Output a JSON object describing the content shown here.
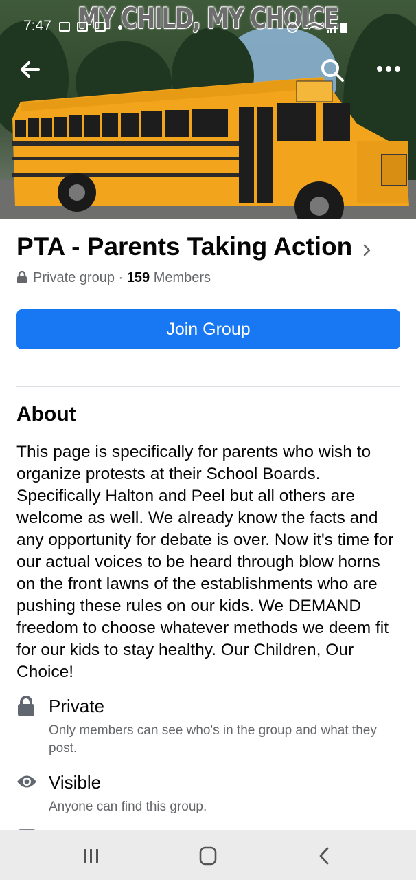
{
  "status_bar": {
    "time": "7:47"
  },
  "cover": {
    "overlay_text": "MY CHILD, MY CHOICE"
  },
  "group": {
    "title": "PTA - Parents Taking Action",
    "privacy": "Private group",
    "separator": "·",
    "member_count": "159",
    "members_label": "Members",
    "join_label": "Join Group"
  },
  "about": {
    "heading": "About",
    "description": "This page is specifically for parents who wish to organize protests at their School Boards. Specifically Halton and Peel but all others are welcome as well. We already know the facts and any opportunity for debate is over.  Now it's time for our actual voices to be heard through blow horns on the front lawns of the establishments who are pushing these rules on our kids.  We DEMAND freedom to choose whatever methods we deem fit for our kids to stay healthy.  Our Children, Our Choice!"
  },
  "info": [
    {
      "icon": "lock-icon",
      "title": "Private",
      "desc": "Only members can see who's in the group and what they post."
    },
    {
      "icon": "eye-icon",
      "title": "Visible",
      "desc": "Anyone can find this group."
    }
  ],
  "colors": {
    "accent": "#1877f2",
    "secondary_text": "#65676b",
    "navbar": "#ebebeb"
  }
}
